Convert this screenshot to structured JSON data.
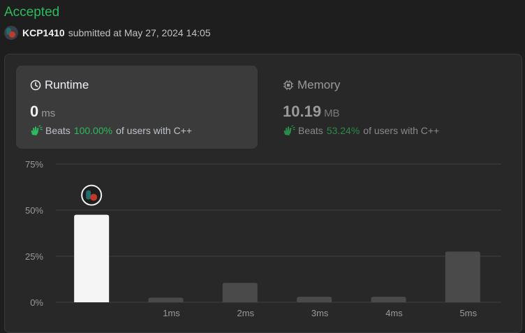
{
  "header": {
    "status": "Accepted",
    "username": "KCP1410",
    "submitted_text": "submitted at May 27, 2024 14:05"
  },
  "runtime": {
    "title": "Runtime",
    "value": "0",
    "unit": "ms",
    "beats_label": "Beats",
    "beats_pct": "100.00%",
    "beats_suffix": "of users with C++"
  },
  "memory": {
    "title": "Memory",
    "value": "10.19",
    "unit": "MB",
    "beats_label": "Beats",
    "beats_pct": "53.24%",
    "beats_suffix": "of users with C++"
  },
  "colors": {
    "accepted": "#2cbb5d",
    "highlight_bar": "#f5f5f5",
    "bar": "#4a4a4a"
  },
  "chart_data": {
    "type": "bar",
    "categories": [
      "",
      "1ms",
      "2ms",
      "3ms",
      "4ms",
      "5ms"
    ],
    "values": [
      47.5,
      2.5,
      10.5,
      3,
      3,
      27.5
    ],
    "highlight_index": 0,
    "y_ticks": [
      "0%",
      "25%",
      "50%",
      "75%"
    ],
    "ylim": [
      0,
      75
    ],
    "grid": true,
    "xlabel": "",
    "ylabel": ""
  }
}
